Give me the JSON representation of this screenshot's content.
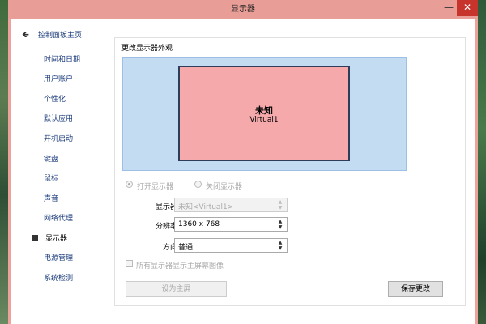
{
  "window": {
    "title": "显示器",
    "minimize_glyph": "—",
    "close_glyph": "✕"
  },
  "sidebar": {
    "back_icon": "arrow-left-icon",
    "back_label": "控制面板主页",
    "items": [
      {
        "label": "时间和日期",
        "current": false
      },
      {
        "label": "用户账户",
        "current": false
      },
      {
        "label": "个性化",
        "current": false
      },
      {
        "label": "默认应用",
        "current": false
      },
      {
        "label": "开机启动",
        "current": false
      },
      {
        "label": "键盘",
        "current": false
      },
      {
        "label": "鼠标",
        "current": false
      },
      {
        "label": "声音",
        "current": false
      },
      {
        "label": "网络代理",
        "current": false
      },
      {
        "label": "显示器",
        "current": true
      },
      {
        "label": "电源管理",
        "current": false
      },
      {
        "label": "系统检测",
        "current": false
      }
    ]
  },
  "main": {
    "section_title": "更改显示器外观",
    "preview": {
      "monitor_name": "未知",
      "monitor_sub": "Virtual1",
      "monitor_color": "#f5a9ab",
      "background_color": "#c4dcf2"
    },
    "radio_on": {
      "label": "打开显示器",
      "checked": true,
      "disabled": true
    },
    "radio_off": {
      "label": "关闭显示器",
      "checked": false,
      "disabled": true
    },
    "fields": {
      "display": {
        "label": "显示器:",
        "value": "未知<Virtual1>",
        "disabled": true
      },
      "resolution": {
        "label": "分辨率:",
        "value": "1360 x 768",
        "disabled": false
      },
      "orientation": {
        "label": "方向:",
        "value": "普通",
        "disabled": false
      }
    },
    "mirror_checkbox": {
      "label": "所有显示器显示主屏幕图像",
      "checked": false,
      "disabled": true
    },
    "set_primary_button": "设为主屏",
    "save_button": "保存更改"
  }
}
